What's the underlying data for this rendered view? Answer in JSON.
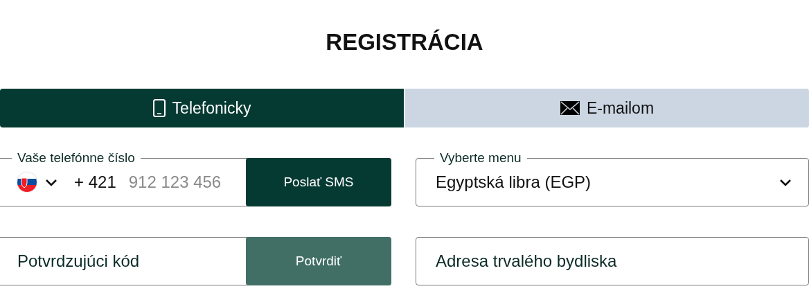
{
  "title": "REGISTRÁCIA",
  "tabs": [
    {
      "label": "Telefonicky",
      "kind": "phone",
      "selected": true
    },
    {
      "label": "E-mailom",
      "kind": "mail",
      "selected": false
    }
  ],
  "phone": {
    "label": "Vaše telefónne číslo",
    "country_code": "+ 421",
    "placeholder": "912 123 456",
    "button": {
      "label": "Poslať SMS",
      "disabled": false
    }
  },
  "currency": {
    "label": "Vyberte menu",
    "value": "Egyptská libra (EGP)"
  },
  "code": {
    "placeholder": "Potvrdzujúci kód",
    "button": {
      "label": "Potvrdiť",
      "disabled": true
    }
  },
  "address": {
    "placeholder": "Adresa trvalého bydliska"
  }
}
